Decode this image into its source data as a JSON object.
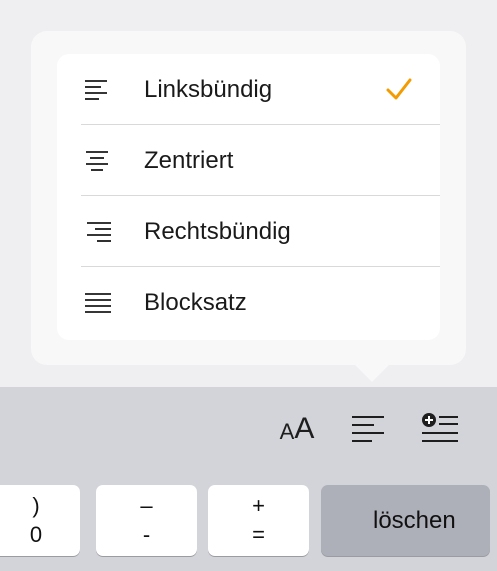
{
  "alignment_menu": {
    "items": [
      {
        "label": "Linksbündig",
        "icon": "align-left-icon",
        "selected": true
      },
      {
        "label": "Zentriert",
        "icon": "align-center-icon",
        "selected": false
      },
      {
        "label": "Rechtsbündig",
        "icon": "align-right-icon",
        "selected": false
      },
      {
        "label": "Blocksatz",
        "icon": "align-justify-icon",
        "selected": false
      }
    ],
    "check_color": "#f49b00"
  },
  "toolbar": {
    "text_size_small": "A",
    "text_size_large": "A"
  },
  "keyboard": {
    "keys": [
      {
        "top": ")",
        "bottom": "0"
      },
      {
        "top": "–",
        "bottom": "-"
      },
      {
        "top": "+",
        "bottom": "="
      }
    ],
    "delete_label": "löschen"
  }
}
